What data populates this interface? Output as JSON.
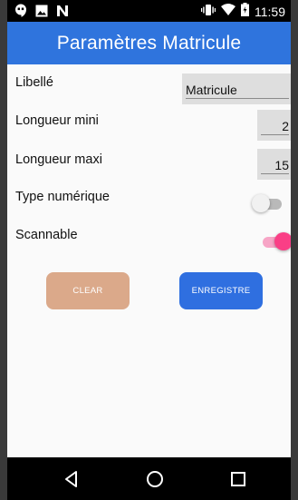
{
  "status_bar": {
    "time": "11:59",
    "left_icons": [
      "hangouts-icon",
      "image-icon",
      "n-notification-icon"
    ],
    "right_icons": [
      "vibrate-icon",
      "wifi-icon",
      "battery-icon"
    ]
  },
  "app_bar": {
    "title": "Paramètres Matricule",
    "color": "#2f74dd"
  },
  "form": {
    "libelle_label": "Libellé",
    "libelle_value": "Matricule",
    "longueur_mini_label": "Longueur mini",
    "longueur_mini_value": "2",
    "longueur_maxi_label": "Longueur maxi",
    "longueur_maxi_value": "15",
    "type_numerique_label": "Type numérique",
    "type_numerique_on": false,
    "scannable_label": "Scannable",
    "scannable_on": true
  },
  "buttons": {
    "clear_label": "CLEAR",
    "clear_color": "#dba98a",
    "save_label": "ENREGISTRE",
    "save_color": "#2f6fe0"
  },
  "nav_bar": {
    "icons": [
      "back-icon",
      "home-icon",
      "recents-icon"
    ]
  }
}
